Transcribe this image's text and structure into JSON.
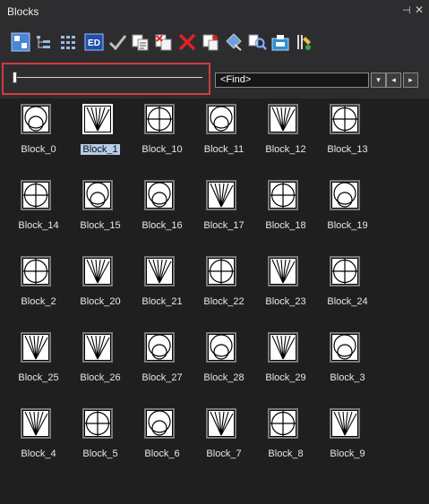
{
  "panel": {
    "title": "Blocks",
    "pin_glyph": "⊣",
    "close_glyph": "✕"
  },
  "toolbar": {
    "icons": [
      "view-large-icon",
      "tree-view-icon",
      "list-view-icon",
      "edit-block-icon",
      "check-icon",
      "copy-block-icon",
      "copy-remove-icon",
      "delete-icon",
      "rename-icon",
      "attribute-icon",
      "find-block-icon",
      "export-icon",
      "block-tools-icon"
    ]
  },
  "search": {
    "find_label": "<Find>"
  },
  "nav": {
    "dropdown_glyph": "▾",
    "prev_glyph": "◂",
    "next_glyph": "▸"
  },
  "colors": {
    "selection_bg": "#b7cde8",
    "highlight": "#d23b3b",
    "panel_bg": "#1f1f1f"
  },
  "blocks": [
    {
      "label": "Block_0",
      "icon": "circle"
    },
    {
      "label": "Block_1",
      "icon": "fan",
      "selected": true
    },
    {
      "label": "Block_10",
      "icon": "cross"
    },
    {
      "label": "Block_11",
      "icon": "circle"
    },
    {
      "label": "Block_12",
      "icon": "fan"
    },
    {
      "label": "Block_13",
      "icon": "cross"
    },
    {
      "label": "Block_14",
      "icon": "cross"
    },
    {
      "label": "Block_15",
      "icon": "circle"
    },
    {
      "label": "Block_16",
      "icon": "circle"
    },
    {
      "label": "Block_17",
      "icon": "fan"
    },
    {
      "label": "Block_18",
      "icon": "cross"
    },
    {
      "label": "Block_19",
      "icon": "circle"
    },
    {
      "label": "Block_2",
      "icon": "cross"
    },
    {
      "label": "Block_20",
      "icon": "fan"
    },
    {
      "label": "Block_21",
      "icon": "fan"
    },
    {
      "label": "Block_22",
      "icon": "cross"
    },
    {
      "label": "Block_23",
      "icon": "fan"
    },
    {
      "label": "Block_24",
      "icon": "cross"
    },
    {
      "label": "Block_25",
      "icon": "fan"
    },
    {
      "label": "Block_26",
      "icon": "fan"
    },
    {
      "label": "Block_27",
      "icon": "circle"
    },
    {
      "label": "Block_28",
      "icon": "circle"
    },
    {
      "label": "Block_29",
      "icon": "fan"
    },
    {
      "label": "Block_3",
      "icon": "circle"
    },
    {
      "label": "Block_4",
      "icon": "fan"
    },
    {
      "label": "Block_5",
      "icon": "cross"
    },
    {
      "label": "Block_6",
      "icon": "circle"
    },
    {
      "label": "Block_7",
      "icon": "fan"
    },
    {
      "label": "Block_8",
      "icon": "cross"
    },
    {
      "label": "Block_9",
      "icon": "fan"
    }
  ]
}
